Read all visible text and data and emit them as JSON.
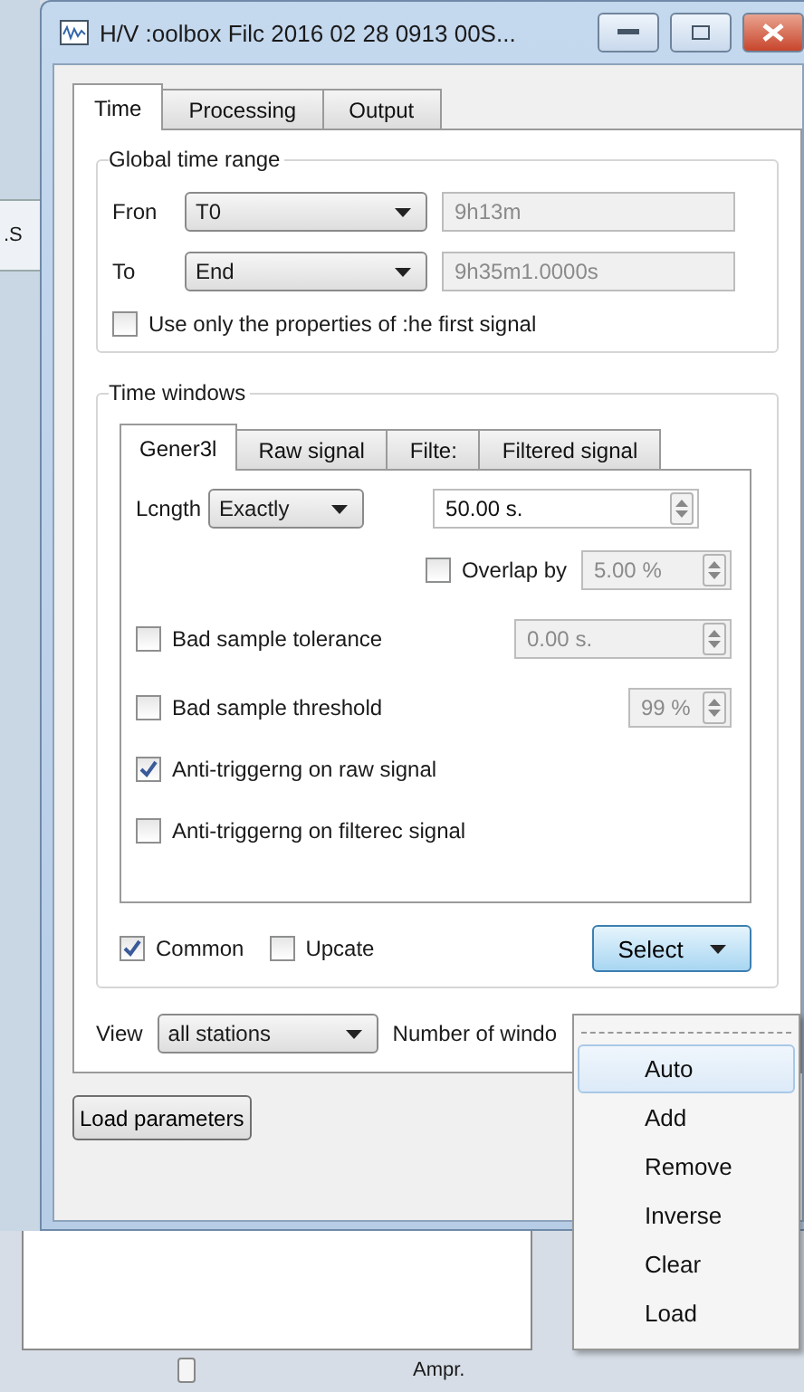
{
  "background": {
    "side_text": ".S",
    "axis_label": "Ampr."
  },
  "window": {
    "title": "H/V :oolbox   Filc 2016 02 28 0913 00S..."
  },
  "tabs": [
    {
      "label": "Time",
      "selected": true
    },
    {
      "label": "Processing",
      "selected": false
    },
    {
      "label": "Output",
      "selected": false
    }
  ],
  "global_time_range": {
    "title": "Global time range",
    "rows": [
      {
        "label": "Fron",
        "combo": "T0",
        "value": "9h13m",
        "disabled": true
      },
      {
        "label": "To",
        "combo": "End",
        "value": "9h35m1.0000s",
        "disabled": true
      }
    ],
    "use_first_signal": {
      "label": "Use only the properties of :he first signal",
      "checked": false
    }
  },
  "time_windows": {
    "title": "Time windows",
    "tabs": [
      {
        "label": "Gener3l",
        "selected": true
      },
      {
        "label": "Raw signal",
        "selected": false
      },
      {
        "label": "Filte:",
        "selected": false
      },
      {
        "label": "Filtered signal",
        "selected": false
      }
    ],
    "length": {
      "label": "Lcngth",
      "combo": "Exactly",
      "value": "50.00 s.",
      "disabled": false
    },
    "overlap": {
      "label": "Overlap by",
      "checked": false,
      "value": "5.00 %",
      "disabled": true
    },
    "options": [
      {
        "kind": "spin",
        "label": "Bad sample tolerance",
        "checked": false,
        "value": "0.00 s."
      },
      {
        "kind": "spin",
        "label": "Bad sample threshold",
        "checked": false,
        "value": "99 %"
      },
      {
        "kind": "check",
        "label": "Anti-triggerng on raw signal",
        "checked": true
      },
      {
        "kind": "check",
        "label": "Anti-triggerng on filterec signal",
        "checked": false
      }
    ],
    "common": {
      "label": "Common",
      "checked": true
    },
    "update": {
      "label": "Upcate",
      "checked": false
    },
    "select_button": "Select"
  },
  "view": {
    "label": "View",
    "combo": "all stations",
    "count_label": "Number of windo"
  },
  "load_button": "Load parameters",
  "menu": [
    {
      "label": "Auto",
      "selected": true
    },
    {
      "label": "Add",
      "selected": false
    },
    {
      "label": "Remove",
      "selected": false
    },
    {
      "label": "Inverse",
      "selected": false
    },
    {
      "label": "Clear",
      "selected": false
    },
    {
      "label": "Load",
      "selected": false
    }
  ]
}
